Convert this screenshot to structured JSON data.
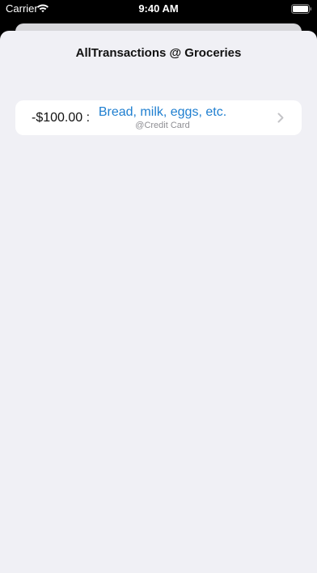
{
  "status_bar": {
    "carrier": "Carrier",
    "time": "9:40 AM"
  },
  "sheet": {
    "title": "AllTransactions @ Groceries"
  },
  "transactions": [
    {
      "amount": "-$100.00 :",
      "description": "Bread, milk, eggs, etc.",
      "account": "@Credit Card"
    }
  ],
  "colors": {
    "accent": "#1f7fd0",
    "background": "#f0f0f5",
    "secondary_text": "#8e8e93"
  }
}
